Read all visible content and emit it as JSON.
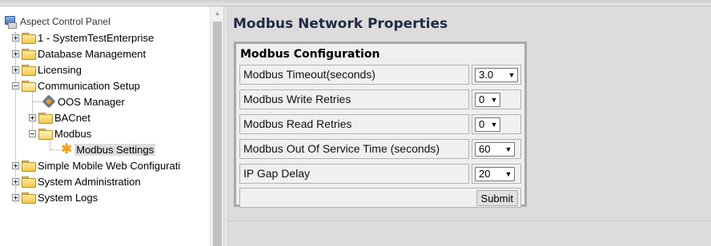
{
  "tree": {
    "root_label": "Aspect Control Panel",
    "items": [
      {
        "label": "1 - SystemTestEnterprise",
        "expanded": false
      },
      {
        "label": "Database Management",
        "expanded": false
      },
      {
        "label": "Licensing",
        "expanded": false
      },
      {
        "label": "Communication Setup",
        "expanded": true,
        "children": [
          {
            "label": "OOS Manager",
            "icon": "gear-icon"
          },
          {
            "label": "BACnet",
            "expanded": false
          },
          {
            "label": "Modbus",
            "expanded": true,
            "children": [
              {
                "label": "Modbus Settings",
                "icon": "star-icon",
                "selected": true
              }
            ]
          }
        ]
      },
      {
        "label": "Simple Mobile Web Configurati",
        "expanded": false
      },
      {
        "label": "System Administration",
        "expanded": false
      },
      {
        "label": "System Logs",
        "expanded": false
      }
    ]
  },
  "main": {
    "title": "Modbus Network Properties",
    "section_title": "Modbus Configuration",
    "fields": [
      {
        "label": "Modbus Timeout(seconds)",
        "value": "3.0"
      },
      {
        "label": "Modbus Write Retries",
        "value": "0"
      },
      {
        "label": "Modbus Read Retries",
        "value": "0"
      },
      {
        "label": "Modbus Out Of Service Time (seconds)",
        "value": "60"
      },
      {
        "label": "IP Gap Delay",
        "value": "20"
      }
    ],
    "submit_label": "Submit"
  },
  "colors": {
    "title": "#1f2a44",
    "main_background": "#dcdcdc",
    "selection": "#dedede"
  }
}
